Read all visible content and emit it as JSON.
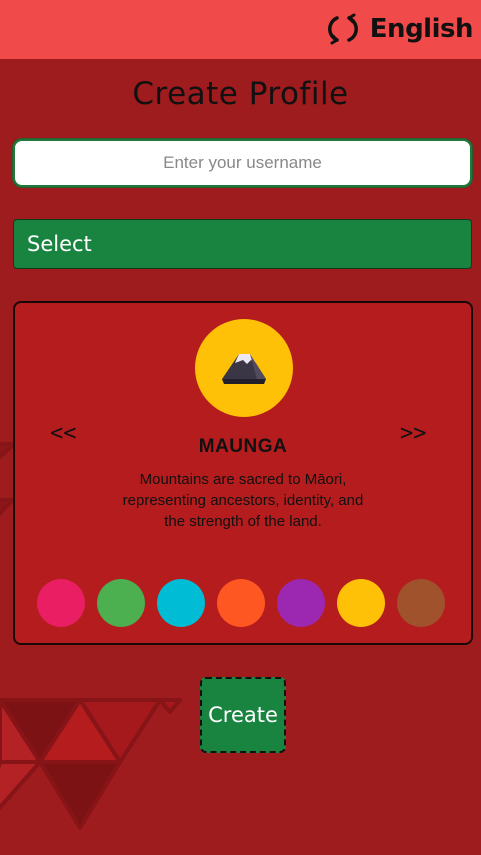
{
  "header": {
    "language_label": "English",
    "language_icon": "refresh-icon"
  },
  "page": {
    "title": "Create Profile"
  },
  "form": {
    "username_placeholder": "Enter your username",
    "username_value": "",
    "select_label": "Select"
  },
  "card": {
    "prev_label": "<<",
    "next_label": ">>",
    "avatar_icon": "mountain-icon",
    "name": "MAUNGA",
    "description": "Mountains are sacred to Māori, representing ancestors, identity, and the strength of the land.",
    "colors": [
      "#e91e63",
      "#4caf50",
      "#00bcd4",
      "#ff5722",
      "#9c27b0",
      "#ffc107",
      "#a0522d"
    ]
  },
  "actions": {
    "create_label": "Create"
  },
  "theme": {
    "background": "#9e1b1e",
    "header": "#f04a4a",
    "card": "#b41c1e",
    "button_green": "#198440",
    "avatar_bg": "#ffc107"
  }
}
